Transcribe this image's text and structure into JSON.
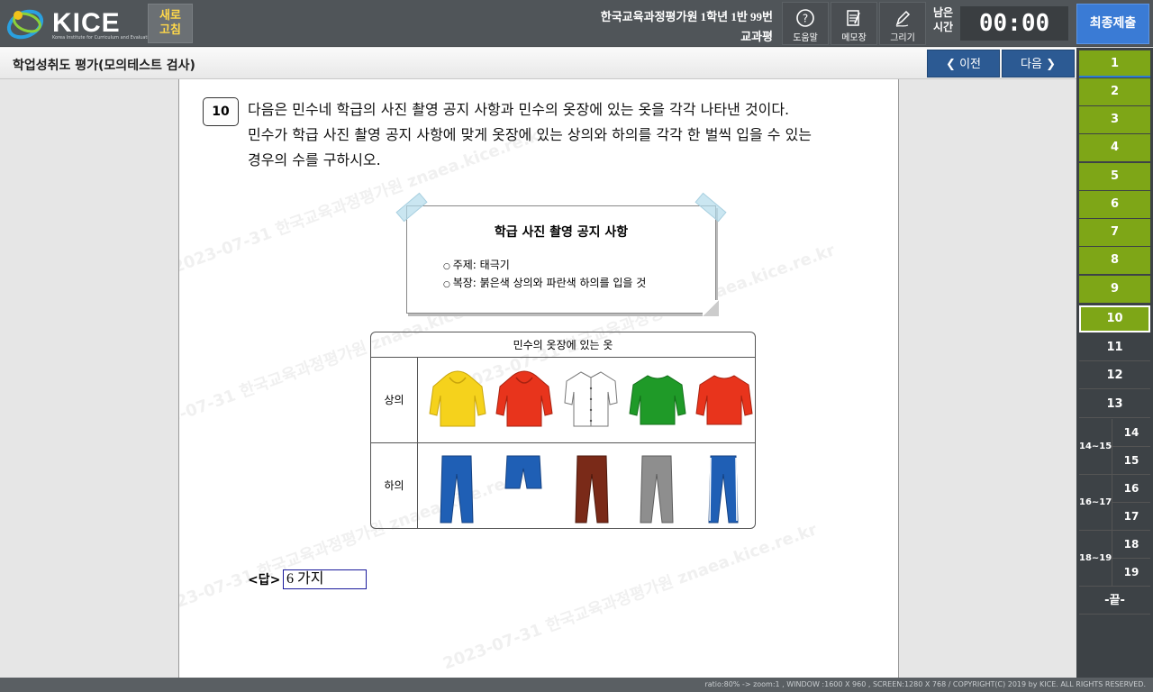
{
  "header": {
    "logo_text": "KICE",
    "logo_sub": "Korea Institute for Curriculum and Evaluation",
    "refresh_line1": "새로",
    "refresh_line2": "고침",
    "exam_title": "한국교육과정평가원 1학년 1반 99번",
    "subject": "교과평",
    "tools": {
      "help": "도움말",
      "memo": "메모장",
      "draw": "그리기"
    },
    "time_label_1": "남은",
    "time_label_2": "시간",
    "timer": "00:00",
    "submit": "최종제출"
  },
  "subbar": {
    "title": "학업성취도 평가(모의테스트 검사)",
    "prev": "이전",
    "next": "다음"
  },
  "question": {
    "number": "10",
    "line1": "다음은 민수네 학급의 사진 촬영 공지 사항과 민수의 옷장에 있는 옷을 각각 나타낸 것이다.",
    "line2": "민수가 학급 사진 촬영 공지 사항에 맞게 옷장에 있는 상의와 하의를 각각 한 벌씩 입을 수 있는",
    "line3": "경우의 수를 구하시오.",
    "notice": {
      "title": "학급 사진 촬영 공지 사항",
      "item1": "주제: 태극기",
      "item2": "복장: 붉은색 상의와 파란색 하의를 입을 것"
    },
    "wardrobe": {
      "title": "민수의 옷장에 있는 옷",
      "tops_label": "상의",
      "bottoms_label": "하의",
      "tops": [
        {
          "name": "yellow-hoodie",
          "color": "#f5d21c"
        },
        {
          "name": "red-hoodie",
          "color": "#e8341c"
        },
        {
          "name": "white-shirt",
          "color": "#ffffff"
        },
        {
          "name": "green-sweater",
          "color": "#1f9a28"
        },
        {
          "name": "red-sweater",
          "color": "#e8341c"
        }
      ],
      "bottoms": [
        {
          "name": "blue-jeans",
          "color": "#1f5fb5"
        },
        {
          "name": "blue-shorts",
          "color": "#1f5fb5"
        },
        {
          "name": "brown-pants",
          "color": "#7a2a18"
        },
        {
          "name": "gray-pants",
          "color": "#8e8e8e"
        },
        {
          "name": "blue-track-pants",
          "color": "#1f5fb5"
        }
      ]
    },
    "answer_label": "<답>",
    "answer_value": "6 가지"
  },
  "qnav": {
    "items": [
      "1",
      "2",
      "3",
      "4",
      "5",
      "6",
      "7",
      "8",
      "9",
      "10",
      "11",
      "12",
      "13"
    ],
    "groups": [
      {
        "label": "14~15",
        "a": "14",
        "b": "15"
      },
      {
        "label": "16~17",
        "a": "16",
        "b": "17"
      },
      {
        "label": "18~19",
        "a": "18",
        "b": "19"
      }
    ],
    "end": "-끝-"
  },
  "watermark": "2023-07-31 한국교육과정평가원 znaea.kice.re.kr",
  "footer": "ratio:80% -> zoom:1 , WINDOW :1600 X 960 , SCREEN:1280 X 768 / COPYRIGHT(C) 2019 by KICE. ALL RIGHTS RESERVED."
}
